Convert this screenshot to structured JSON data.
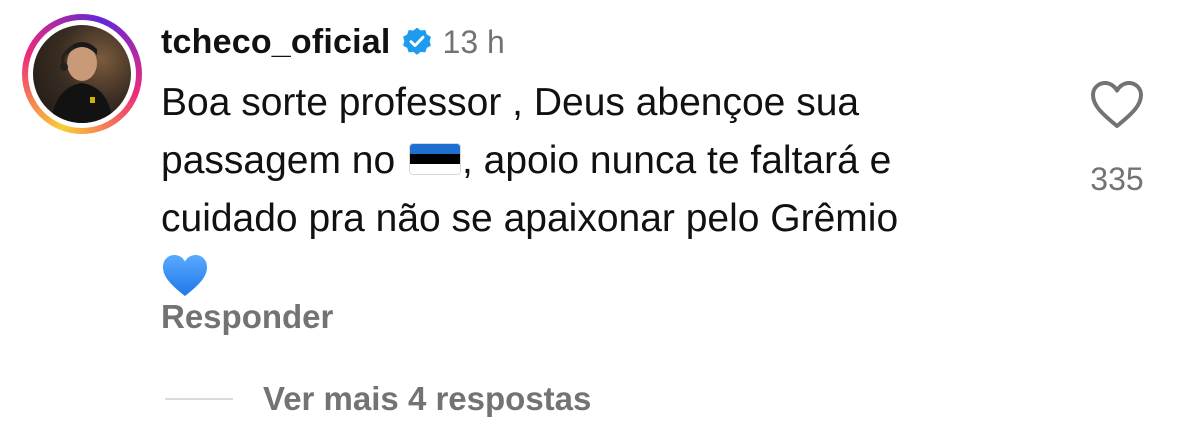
{
  "comment": {
    "username": "tcheco_oficial",
    "verified": true,
    "time": "13 h",
    "text_line1": "Boa sorte professor , Deus abençoe sua",
    "text_line2_before_flag": "passagem no ",
    "flag_emoji": "estonia-flag-icon",
    "text_line2_after_flag": ", apoio nunca te faltará e",
    "text_line3": "cuidado pra não se apaixonar pelo Grêmio",
    "end_emoji": "blue-heart-icon",
    "likes": "335",
    "reply_label": "Responder",
    "more_replies_label": "Ver mais 4 respostas"
  },
  "colors": {
    "text_primary": "#111111",
    "text_secondary": "#737373",
    "verified_blue": "#1d9bf0",
    "flag_blue": "#1f6fd1",
    "flag_black": "#000000",
    "flag_white": "#ffffff",
    "emoji_heart_blue": "#2f8cf4",
    "divider": "#dbdbdb"
  }
}
